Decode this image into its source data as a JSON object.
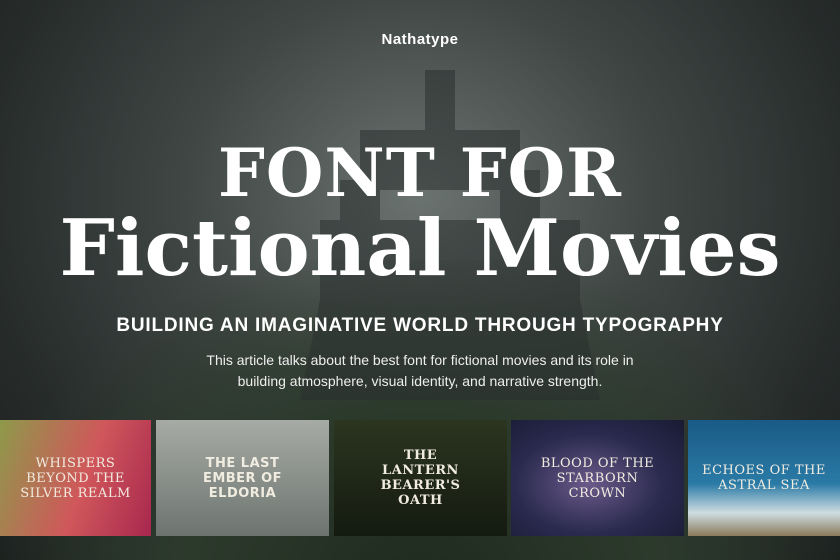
{
  "brand": "Nathatype",
  "title_line1": "FONT FOR",
  "title_line2": "Fictional Movies",
  "subtitle": "BUILDING AN IMAGINATIVE WORLD THROUGH TYPOGRAPHY",
  "description_line1": "This article talks about the best font for fictional movies and its role in",
  "description_line2": "building atmosphere, visual identity, and narrative strength.",
  "thumbnails": [
    {
      "title": "WHISPERS BEYOND THE SILVER REALM"
    },
    {
      "title": "THE LAST EMBER OF ELDORIA"
    },
    {
      "title": "THE LANTERN BEARER'S OATH"
    },
    {
      "title": "BLOOD OF THE STARBORN CROWN"
    },
    {
      "title": "ECHOES OF THE ASTRAL SEA"
    }
  ]
}
